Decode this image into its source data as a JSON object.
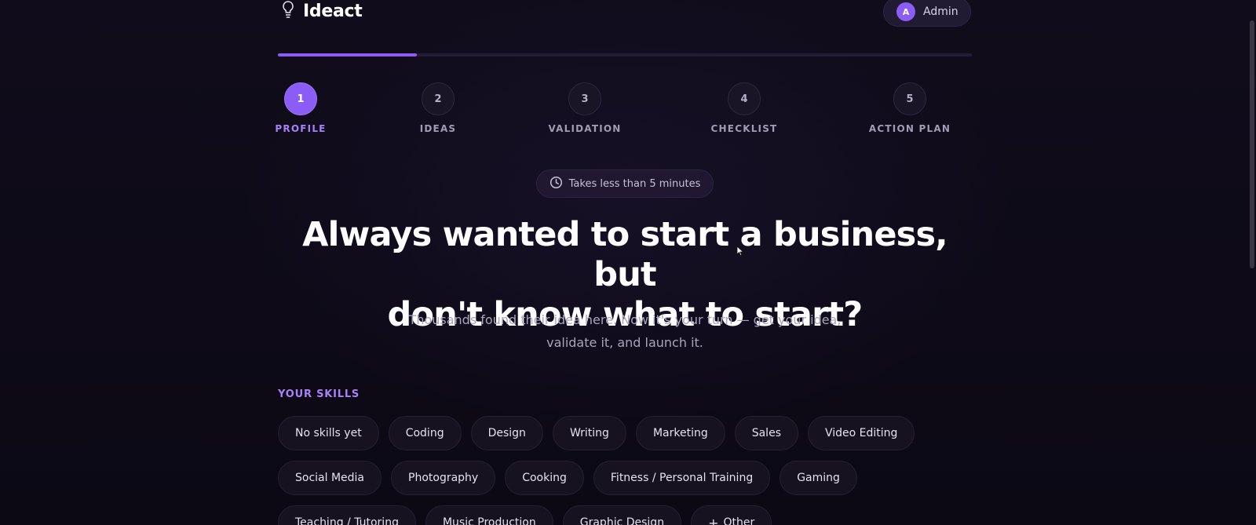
{
  "header": {
    "brand_name": "Ideact",
    "brand_icon": "lightbulb-icon",
    "user": {
      "avatar_letter": "A",
      "name": "Admin"
    }
  },
  "progress": {
    "value": 0.2,
    "accent": "#8b5cf6"
  },
  "steps": [
    {
      "number": "1",
      "label": "PROFILE",
      "active": true
    },
    {
      "number": "2",
      "label": "IDEAS",
      "active": false
    },
    {
      "number": "3",
      "label": "VALIDATION",
      "active": false
    },
    {
      "number": "4",
      "label": "CHECKLIST",
      "active": false
    },
    {
      "number": "5",
      "label": "ACTION PLAN",
      "active": false
    }
  ],
  "badge": {
    "icon": "clock-icon",
    "text": "Takes less than 5 minutes"
  },
  "hero": {
    "headline_line1": "Always wanted to start a business, but",
    "headline_line2": "don't know what to start?",
    "subtitle_line1": "Thousands found their idea here. Now it's your turn — get your idea,",
    "subtitle_line2": "validate it, and launch it."
  },
  "skills": {
    "label": "YOUR SKILLS",
    "rows": [
      [
        "No skills yet",
        "Coding",
        "Design",
        "Writing",
        "Marketing",
        "Sales",
        "Video Editing"
      ],
      [
        "Social Media",
        "Photography",
        "Cooking",
        "Fitness / Personal Training",
        "Gaming"
      ],
      [
        "Teaching / Tutoring",
        "Music Production",
        "Graphic Design",
        "Other"
      ]
    ]
  },
  "colors": {
    "background": "#0d0a16",
    "accent": "#8b5cf6",
    "accent_text": "#a781f7"
  }
}
